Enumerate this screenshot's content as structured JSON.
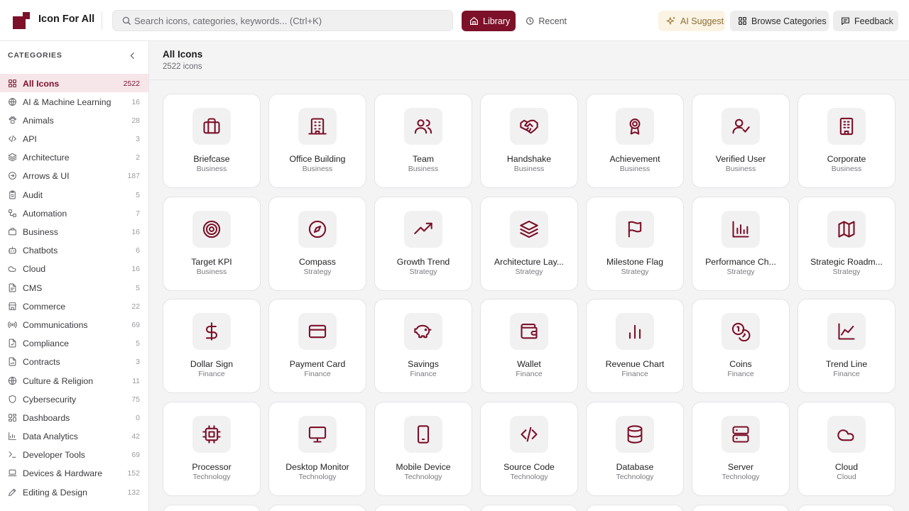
{
  "app": {
    "title": "Icon For All",
    "brand_color": "#7d1129"
  },
  "search": {
    "placeholder": "Search icons, categories, keywords... (Ctrl+K)"
  },
  "nav": {
    "library_label": "Library",
    "recent_label": "Recent",
    "ai_label": "AI Suggest",
    "browse_label": "Browse Categories",
    "feedback_label": "Feedback"
  },
  "sidebar": {
    "title": "CATEGORIES",
    "items": [
      {
        "label": "All Icons",
        "count": "2522",
        "icon": "grid-icon",
        "active": true
      },
      {
        "label": "AI & Machine Learning",
        "count": "16",
        "icon": "brain-icon"
      },
      {
        "label": "Animals",
        "count": "28",
        "icon": "paw-icon"
      },
      {
        "label": "API",
        "count": "3",
        "icon": "code-icon"
      },
      {
        "label": "Architecture",
        "count": "2",
        "icon": "layers-icon"
      },
      {
        "label": "Arrows & UI",
        "count": "187",
        "icon": "arrows-icon"
      },
      {
        "label": "Audit",
        "count": "5",
        "icon": "clipboard-icon"
      },
      {
        "label": "Automation",
        "count": "7",
        "icon": "workflow-icon"
      },
      {
        "label": "Business",
        "count": "16",
        "icon": "briefcase-icon"
      },
      {
        "label": "Chatbots",
        "count": "6",
        "icon": "bot-icon"
      },
      {
        "label": "Cloud",
        "count": "16",
        "icon": "cloud-icon"
      },
      {
        "label": "CMS",
        "count": "5",
        "icon": "document-icon"
      },
      {
        "label": "Commerce",
        "count": "22",
        "icon": "store-icon"
      },
      {
        "label": "Communications",
        "count": "69",
        "icon": "broadcast-icon"
      },
      {
        "label": "Compliance",
        "count": "5",
        "icon": "file-check-icon"
      },
      {
        "label": "Contracts",
        "count": "3",
        "icon": "file-signature-icon"
      },
      {
        "label": "Culture & Religion",
        "count": "11",
        "icon": "globe-icon"
      },
      {
        "label": "Cybersecurity",
        "count": "75",
        "icon": "shield-icon"
      },
      {
        "label": "Dashboards",
        "count": "0",
        "icon": "dashboard-icon"
      },
      {
        "label": "Data Analytics",
        "count": "42",
        "icon": "chart-icon"
      },
      {
        "label": "Developer Tools",
        "count": "69",
        "icon": "terminal-icon"
      },
      {
        "label": "Devices & Hardware",
        "count": "152",
        "icon": "laptop-icon"
      },
      {
        "label": "Editing & Design",
        "count": "132",
        "icon": "pen-icon"
      }
    ]
  },
  "main": {
    "title": "All Icons",
    "count_text": "2522 icons",
    "cards": [
      {
        "name": "Briefcase",
        "category": "Business",
        "icon": "briefcase"
      },
      {
        "name": "Office Building",
        "category": "Business",
        "icon": "office"
      },
      {
        "name": "Team",
        "category": "Business",
        "icon": "team"
      },
      {
        "name": "Handshake",
        "category": "Business",
        "icon": "handshake"
      },
      {
        "name": "Achievement",
        "category": "Business",
        "icon": "award"
      },
      {
        "name": "Verified User",
        "category": "Business",
        "icon": "user-check"
      },
      {
        "name": "Corporate",
        "category": "Business",
        "icon": "corporate"
      },
      {
        "name": "Target KPI",
        "category": "Business",
        "icon": "target"
      },
      {
        "name": "Compass",
        "category": "Strategy",
        "icon": "compass"
      },
      {
        "name": "Growth Trend",
        "category": "Strategy",
        "icon": "trend-up"
      },
      {
        "name": "Architecture Lay...",
        "category": "Strategy",
        "icon": "layers"
      },
      {
        "name": "Milestone Flag",
        "category": "Strategy",
        "icon": "flag"
      },
      {
        "name": "Performance Ch...",
        "category": "Strategy",
        "icon": "bar-chart"
      },
      {
        "name": "Strategic Roadm...",
        "category": "Strategy",
        "icon": "map"
      },
      {
        "name": "Dollar Sign",
        "category": "Finance",
        "icon": "dollar"
      },
      {
        "name": "Payment Card",
        "category": "Finance",
        "icon": "card"
      },
      {
        "name": "Savings",
        "category": "Finance",
        "icon": "piggy"
      },
      {
        "name": "Wallet",
        "category": "Finance",
        "icon": "wallet"
      },
      {
        "name": "Revenue Chart",
        "category": "Finance",
        "icon": "revenue"
      },
      {
        "name": "Coins",
        "category": "Finance",
        "icon": "coins"
      },
      {
        "name": "Trend Line",
        "category": "Finance",
        "icon": "line-chart"
      },
      {
        "name": "Processor",
        "category": "Technology",
        "icon": "cpu"
      },
      {
        "name": "Desktop Monitor",
        "category": "Technology",
        "icon": "monitor"
      },
      {
        "name": "Mobile Device",
        "category": "Technology",
        "icon": "phone"
      },
      {
        "name": "Source Code",
        "category": "Technology",
        "icon": "code"
      },
      {
        "name": "Database",
        "category": "Technology",
        "icon": "database"
      },
      {
        "name": "Server",
        "category": "Technology",
        "icon": "server"
      },
      {
        "name": "Cloud",
        "category": "Cloud",
        "icon": "cloud"
      }
    ]
  }
}
